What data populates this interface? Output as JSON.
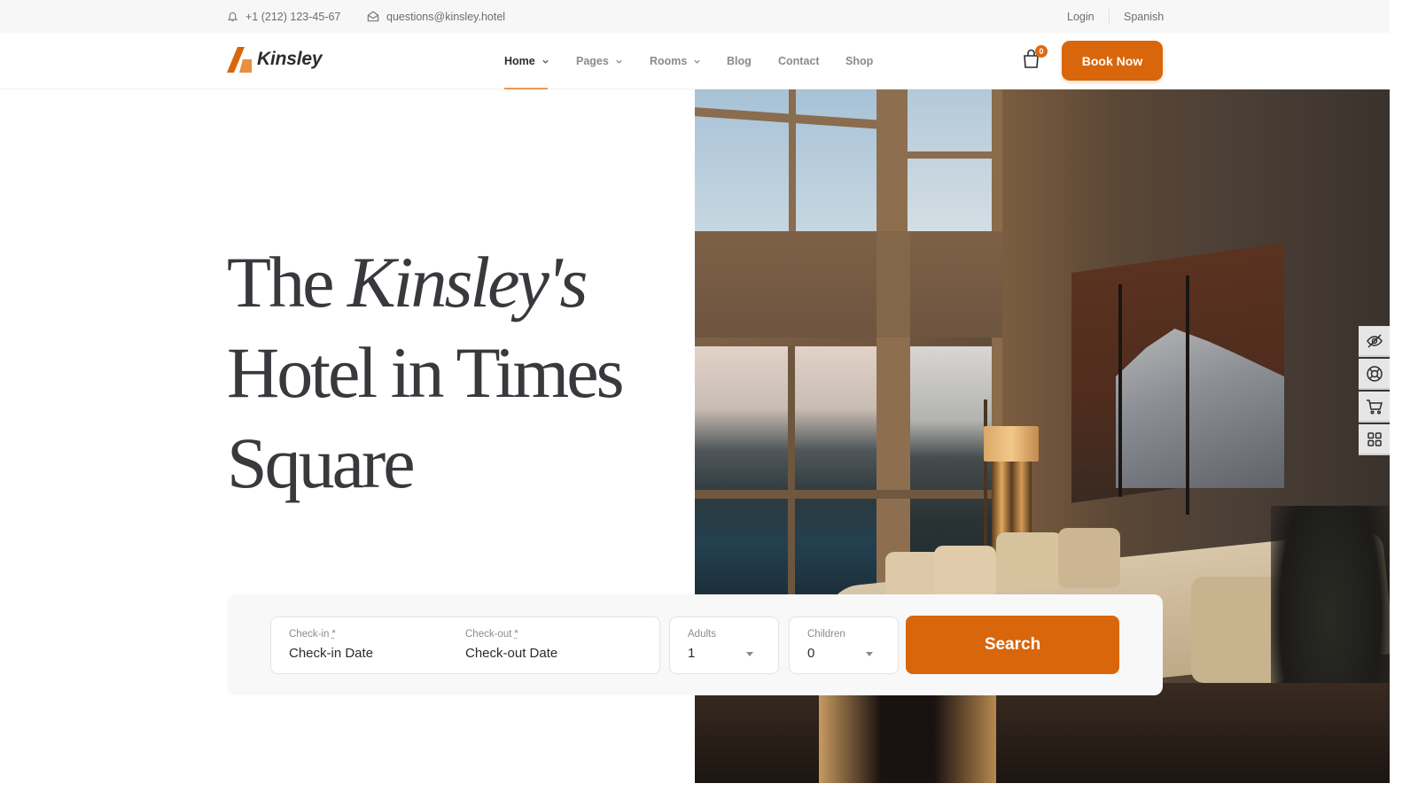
{
  "topbar": {
    "phone": "+1 (212) 123-45-67",
    "email": "questions@kinsley.hotel",
    "login": "Login",
    "language": "Spanish"
  },
  "header": {
    "logo_text": "Kinsley",
    "nav": [
      {
        "label": "Home",
        "dropdown": true,
        "active": true
      },
      {
        "label": "Pages",
        "dropdown": true,
        "active": false
      },
      {
        "label": "Rooms",
        "dropdown": true,
        "active": false
      },
      {
        "label": "Blog",
        "dropdown": false,
        "active": false
      },
      {
        "label": "Contact",
        "dropdown": false,
        "active": false
      },
      {
        "label": "Shop",
        "dropdown": false,
        "active": false
      }
    ],
    "cart_count": "0",
    "book_now": "Book Now"
  },
  "hero": {
    "title_line1_prefix": "The",
    "title_line1_italic": "Kinsley's",
    "title_line2": "Hotel in Times",
    "title_line3": "Square"
  },
  "sidebar": {
    "icons": [
      "eye-off-icon",
      "lifebuoy-icon",
      "cart-icon",
      "grid-icon"
    ]
  },
  "booking": {
    "checkin_label": "Check-in",
    "checkin_value": "Check-in Date",
    "checkout_label": "Check-out",
    "checkout_value": "Check-out Date",
    "required_mark": "*",
    "adults_label": "Adults",
    "adults_value": "1",
    "children_label": "Children",
    "children_value": "0",
    "search": "Search"
  },
  "colors": {
    "accent": "#d9660b",
    "nav_underline": "#ea9a50",
    "text_dark": "#2c2c30",
    "text_muted": "#8a8a8f"
  }
}
